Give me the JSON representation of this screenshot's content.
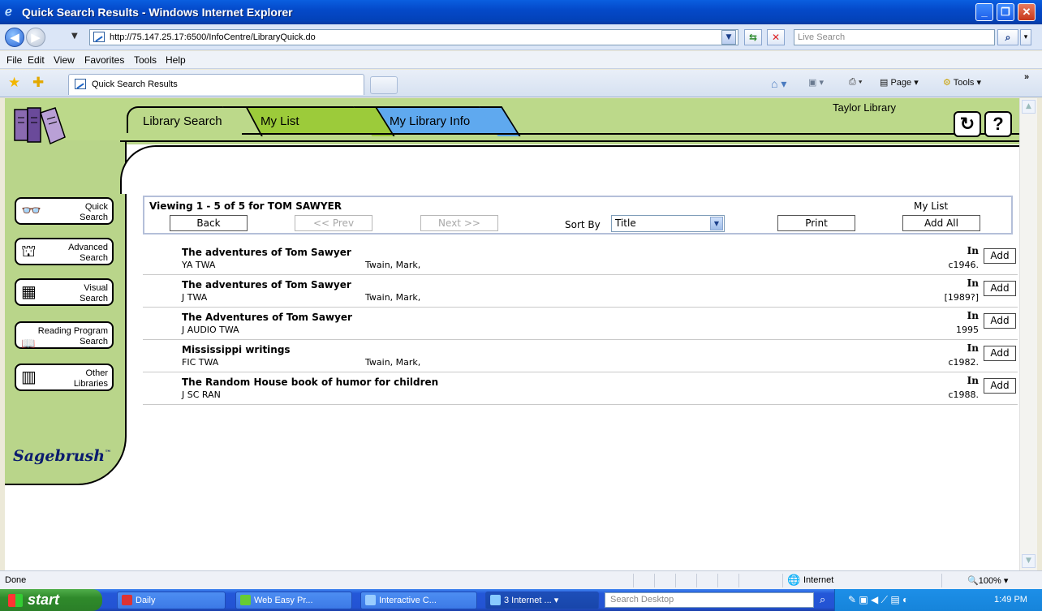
{
  "window": {
    "title": "Quick Search Results - Windows Internet Explorer"
  },
  "address": {
    "url": "http://75.147.25.17:6500/InfoCentre/LibraryQuick.do",
    "search_placeholder": "Live Search"
  },
  "menu": [
    "File",
    "Edit",
    "View",
    "Favorites",
    "Tools",
    "Help"
  ],
  "tab": {
    "title": "Quick Search Results"
  },
  "command_bar": {
    "page_label": "Page",
    "tools_label": "Tools"
  },
  "library": {
    "name": "Taylor Library"
  },
  "nav_tabs": [
    "Library Search",
    "My List",
    "My Library Info"
  ],
  "sidebar": {
    "buttons": [
      {
        "line1": "Quick",
        "line2": "Search",
        "icon": "binoculars-icon"
      },
      {
        "line1": "Advanced",
        "line2": "Search",
        "icon": "dome-icon"
      },
      {
        "line1": "Visual",
        "line2": "Search",
        "icon": "grid-icon"
      },
      {
        "line1": "Reading Program",
        "line2": "Search",
        "icon": "open-book-icon"
      },
      {
        "line1": "Other",
        "line2": "Libraries",
        "icon": "building-icon"
      }
    ],
    "brand": "Sagebrush"
  },
  "results_panel": {
    "viewing_text": "Viewing 1 - 5 of 5 for TOM SAWYER",
    "back": "Back",
    "prev": "<< Prev",
    "next": "Next >>",
    "sort_label": "Sort By",
    "sort_value": "Title",
    "print": "Print",
    "mylist_label": "My List",
    "add_all": "Add All"
  },
  "results": [
    {
      "title": "The adventures of Tom Sawyer",
      "call": "YA TWA",
      "author": "Twain, Mark,",
      "status": "In",
      "date": "c1946.",
      "add": "Add"
    },
    {
      "title": "The adventures of Tom Sawyer",
      "call": "J TWA",
      "author": "Twain, Mark,",
      "status": "In",
      "date": "[1989?]",
      "add": "Add"
    },
    {
      "title": "The Adventures of Tom Sawyer",
      "call": "J AUDIO TWA",
      "author": "",
      "status": "In",
      "date": "1995",
      "add": "Add"
    },
    {
      "title": "Mississippi writings",
      "call": "FIC TWA",
      "author": "Twain, Mark,",
      "status": "In",
      "date": "c1982.",
      "add": "Add"
    },
    {
      "title": "The Random House book of humor for children",
      "call": "J SC RAN",
      "author": "",
      "status": "In",
      "date": "c1988.",
      "add": "Add"
    }
  ],
  "status": {
    "left": "Done",
    "zone": "Internet",
    "zoom": "100%"
  },
  "taskbar": {
    "start": "start",
    "tasks": [
      "Daily",
      "Web Easy Pr...",
      "Interactive C...",
      "3 Internet ..."
    ],
    "search_placeholder": "Search Desktop",
    "time": "1:49 PM"
  }
}
